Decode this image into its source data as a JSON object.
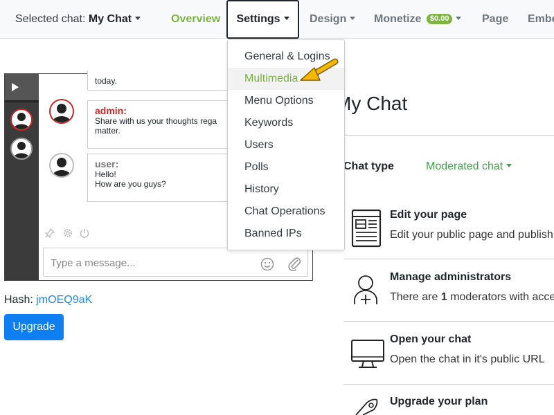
{
  "nav": {
    "selected_prefix": "Selected chat:",
    "selected_name": "My Chat",
    "overview": "Overview",
    "settings": "Settings",
    "design": "Design",
    "monetize": "Monetize",
    "monetize_badge": "$0.00",
    "page": "Page",
    "embed": "Embe"
  },
  "settings_menu": {
    "items": [
      "General & Logins",
      "Multimedia",
      "Menu Options",
      "Keywords",
      "Users",
      "Polls",
      "History",
      "Chat Operations",
      "Banned IPs"
    ],
    "active": "Multimedia"
  },
  "chat_preview": {
    "messages": [
      {
        "author": "",
        "text": "today."
      },
      {
        "author": "admin:",
        "text": "Share with us your thoughts rega",
        "text2": "matter."
      },
      {
        "author": "user:",
        "text": "Hello!",
        "text2": "How are you guys?"
      }
    ],
    "input_placeholder": "Type a message..."
  },
  "hash": {
    "label": "Hash:",
    "value": "jmOEQ9aK"
  },
  "upgrade_label": "Upgrade",
  "main": {
    "title": "My Chat",
    "chat_type_label": "Chat type",
    "chat_type_value": "Moderated chat",
    "cards": [
      {
        "icon": "page-icon",
        "title": "Edit your page",
        "desc": "Edit your public page and publish"
      },
      {
        "icon": "user-add-icon",
        "title": "Manage administrators",
        "desc_pre": "There are",
        "desc_count": "1",
        "desc_post": "moderators with acce"
      },
      {
        "icon": "monitor-icon",
        "title": "Open your chat",
        "desc": "Open the chat in it's public URL"
      },
      {
        "icon": "rocket-icon",
        "title": "Upgrade your plan",
        "desc": ""
      }
    ]
  },
  "colors": {
    "accent_green": "#7cb342",
    "link_blue": "#1e88e5",
    "primary_button": "#0d7ff0",
    "admin_red": "#c62828",
    "pointer_arrow": "#f5b800"
  }
}
